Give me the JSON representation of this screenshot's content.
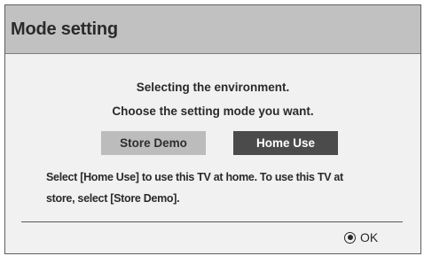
{
  "dialog": {
    "title": "Mode setting",
    "line1": "Selecting the environment.",
    "line2": "Choose the setting mode you want.",
    "buttons": [
      {
        "label": "Store Demo",
        "selected": false
      },
      {
        "label": "Home Use",
        "selected": true
      }
    ],
    "description_line1": "Select [Home Use] to use this TV at home. To use this TV at",
    "description_line2": "store, select [Store Demo].",
    "ok_icon": "ok-button-icon",
    "ok_label": "OK"
  }
}
